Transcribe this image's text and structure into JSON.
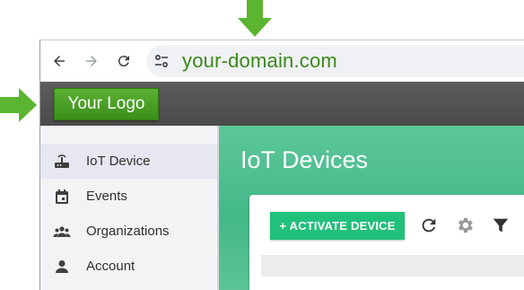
{
  "browser": {
    "url": "your-domain.com"
  },
  "header": {
    "logo_text": "Your Logo"
  },
  "sidebar": {
    "items": [
      {
        "label": "IoT Device",
        "icon": "router-icon",
        "active": true
      },
      {
        "label": "Events",
        "icon": "calendar-icon",
        "active": false
      },
      {
        "label": "Organizations",
        "icon": "people-icon",
        "active": false
      },
      {
        "label": "Account",
        "icon": "person-icon",
        "active": false
      }
    ]
  },
  "main": {
    "title": "IoT Devices",
    "activate_button": "+ ACTIVATE DEVICE",
    "tools": [
      "refresh-icon",
      "settings-icon",
      "filter-icon"
    ]
  },
  "colors": {
    "arrow": "#5cb531",
    "url_text": "#3a8a1a",
    "header_bg": "#505050",
    "logo_bg": "#4aa126",
    "accent": "#21c07b",
    "main_bg": "#4dbd8d"
  }
}
